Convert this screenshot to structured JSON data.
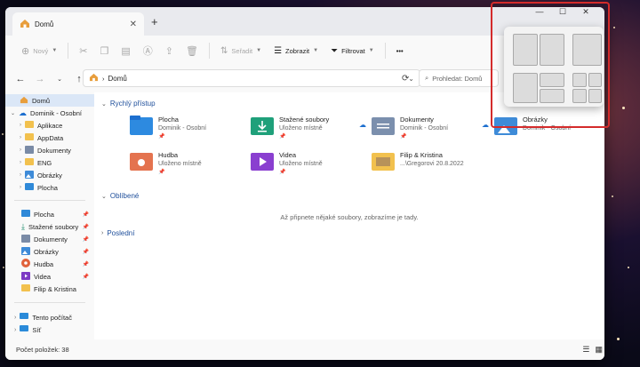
{
  "window": {
    "tab_title": "Domů",
    "tab_close": "✕",
    "new_tab": "+"
  },
  "controls": {
    "minimize": "—",
    "maximize": "☐",
    "close": "✕"
  },
  "toolbar": {
    "new_label": "Nový",
    "sort_label": "Seřadit",
    "view_label": "Zobrazit",
    "filter_label": "Filtrovat",
    "more_label": "•••"
  },
  "address": {
    "path": "Domů",
    "separator": "›",
    "search_placeholder": "Prohledat: Domů"
  },
  "sidebar": {
    "tree": [
      {
        "label": "Domů"
      },
      {
        "label": "Dominik - Osobní"
      },
      {
        "label": "Aplikace"
      },
      {
        "label": "AppData"
      },
      {
        "label": "Dokumenty"
      },
      {
        "label": "ENG"
      },
      {
        "label": "Obrázky"
      },
      {
        "label": "Plocha"
      }
    ],
    "pinned": [
      {
        "label": "Plocha"
      },
      {
        "label": "Stažené soubory"
      },
      {
        "label": "Dokumenty"
      },
      {
        "label": "Obrázky"
      },
      {
        "label": "Hudba"
      },
      {
        "label": "Videa"
      },
      {
        "label": "Filip & Kristina"
      }
    ],
    "bottom": [
      {
        "label": "Tento počítač"
      },
      {
        "label": "Síť"
      }
    ]
  },
  "main": {
    "quick_access_title": "Rychlý přístup",
    "favorites_title": "Oblíbené",
    "recent_title": "Poslední",
    "favorites_empty": "Až připnete nějaké soubory, zobrazíme je tady.",
    "items": [
      {
        "name": "Plocha",
        "sub": "Dominik - Osobní"
      },
      {
        "name": "Stažené soubory",
        "sub": "Uloženo místně"
      },
      {
        "name": "Dokumenty",
        "sub": "Dominik - Osobní"
      },
      {
        "name": "Obrázky",
        "sub": "Dominik - Osobní"
      },
      {
        "name": "Hudba",
        "sub": "Uloženo místně"
      },
      {
        "name": "Videa",
        "sub": "Uloženo místně"
      },
      {
        "name": "Filip & Kristina",
        "sub": "...\\Gregorovi 20.8.2022"
      }
    ],
    "pin_glyph": "📌"
  },
  "status": {
    "count": "Počet položek: 38"
  },
  "colors": {
    "snap_highlight": "#d42b2b",
    "selected": "#dbe7f7",
    "accent": "#0067c0"
  }
}
